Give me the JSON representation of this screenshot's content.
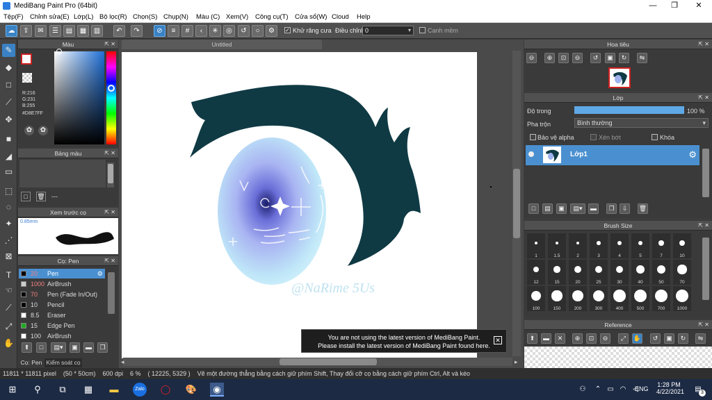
{
  "window": {
    "title": "MediBang Paint Pro (64bit)",
    "minimize": "—",
    "maximize": "❐",
    "close": "✕"
  },
  "menu": [
    "Tệp(F)",
    "Chỉnh sửa(E)",
    "Lớp(L)",
    "Bộ lọc(R)",
    "Chọn(S)",
    "Chụp(N)",
    "Màu (C)",
    "Xem(V)",
    "Công cụ(T)",
    "Cửa sổ(W)",
    "Cloud",
    "Help"
  ],
  "toolbar": {
    "antialias_label": "Khử răng cưa",
    "adjust_label": "Điều chỉnh",
    "adjust_value": "0",
    "smooth_label": "Canh mềm"
  },
  "color_panel": {
    "title": "Màu",
    "r": "R:216",
    "g": "G:231",
    "b": "B:255",
    "hex": "#D8E7FF",
    "primary_color": "#d8e7ff",
    "accent": "#cc2222"
  },
  "palette_panel": {
    "title": "Bảng màu",
    "dash": "---"
  },
  "brush_preview": {
    "title": "Xem trước cọ",
    "size": "0.85mm"
  },
  "brush_panel": {
    "title": "Cọ: Pen",
    "rows": [
      {
        "size": "20",
        "name": "Pen",
        "color": "#000000",
        "selected": true
      },
      {
        "size": "1000",
        "name": "AirBrush",
        "color": "#cccccc",
        "selected": false
      },
      {
        "size": "70",
        "name": "Pen (Fade In/Out)",
        "color": "#000000",
        "selected": false
      },
      {
        "size": "10",
        "name": "Pencil",
        "color": "#000000",
        "selected": false
      },
      {
        "size": "8.5",
        "name": "Eraser",
        "color": "#ffffff",
        "selected": false
      },
      {
        "size": "15",
        "name": "Edge Pen",
        "color": "#22aa22",
        "selected": false
      },
      {
        "size": "100",
        "name": "AirBrush",
        "color": "#ffffff",
        "selected": false
      }
    ]
  },
  "left_tabs": {
    "brush": "Cọ: Pen",
    "control": "Kiểm soát cọ"
  },
  "document": {
    "tab": "Untitled",
    "watermark": "@NaRime 5Us"
  },
  "notice": {
    "line1": "You are not using the latest version of MediBang Paint.",
    "line2": "Please install the latest version of MediBang Paint found here."
  },
  "navigator": {
    "title": "Hoa tiêu"
  },
  "layer_panel": {
    "title": "Lớp",
    "opacity_label": "Độ trong",
    "opacity_value": "100 %",
    "opacity": 1.0,
    "blend_label": "Pha trộn",
    "blend_value": "Bình thường",
    "protect_alpha": "Bảo vệ alpha",
    "clipping": "Xén bớt",
    "lock": "Khóa",
    "layer_name": "Lớp1"
  },
  "brush_size": {
    "title": "Brush Size",
    "sizes": [
      "1",
      "1.5",
      "2",
      "3",
      "4",
      "5",
      "7",
      "10",
      "12",
      "15",
      "20",
      "25",
      "30",
      "40",
      "50",
      "70",
      "100",
      "150",
      "200",
      "300",
      "400",
      "500",
      "700",
      "1000"
    ]
  },
  "reference": {
    "title": "Reference"
  },
  "status": {
    "dimensions": "11811 * 11811 pixel",
    "physical": "(50 * 50cm)",
    "dpi": "600 dpi",
    "zoom": "6 %",
    "coords": "( 12225, 5329 )",
    "hint": "Vẽ một đường thẳng bằng cách giữ phím Shift, Thay đổi cỡ cọ bằng cách giữ phím Ctrl, Alt và kéo"
  },
  "taskbar": {
    "lang": "ENG",
    "time": "1:28 PM",
    "date": "4/22/2021",
    "notifications": "3"
  }
}
